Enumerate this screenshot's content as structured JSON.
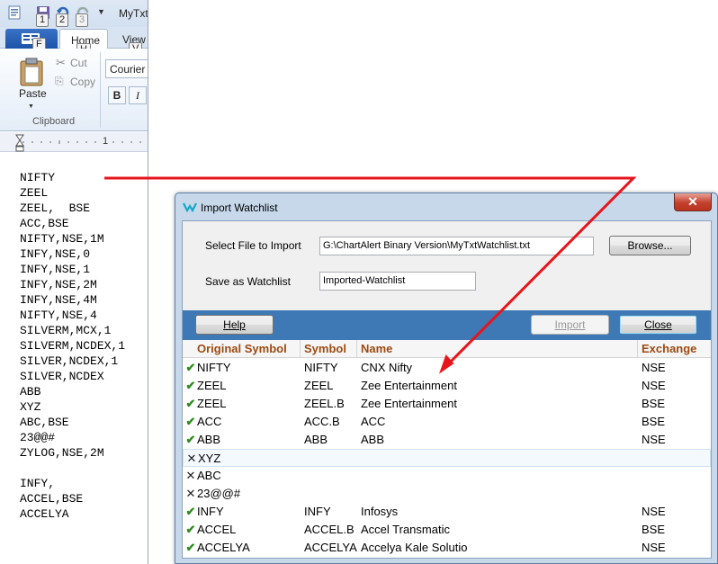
{
  "editor": {
    "quick_access": {
      "keytips": [
        "1",
        "2",
        "3"
      ],
      "title_truncated": "MyTxt"
    },
    "app_button_keytip": "F",
    "tabs": [
      {
        "label": "Home",
        "keytip": "H"
      },
      {
        "label": "View",
        "keytip": "V"
      }
    ],
    "clipboard": {
      "paste": "Paste",
      "cut": "Cut",
      "copy": "Copy",
      "group": "Clipboard"
    },
    "font": {
      "name": "Courier",
      "bold": "B",
      "italic": "I"
    },
    "ruler_mark": "1",
    "lines": [
      "NIFTY",
      "ZEEL",
      "ZEEL,  BSE",
      "ACC,BSE",
      "NIFTY,NSE,1M",
      "INFY,NSE,0",
      "INFY,NSE,1",
      "INFY,NSE,2M",
      "INFY,NSE,4M",
      "NIFTY,NSE,4",
      "SILVERM,MCX,1",
      "SILVERM,NCDEX,1",
      "SILVER,NCDEX,1",
      "SILVER,NCDEX",
      "ABB",
      "XYZ",
      "ABC,BSE",
      "23@@#",
      "ZYLOG,NSE,2M",
      "",
      "INFY,",
      "ACCEL,BSE",
      "ACCELYA"
    ]
  },
  "dialog": {
    "title": "Import Watchlist",
    "close_glyph": "✕",
    "select_file_label": "Select File to Import",
    "file_path": "G:\\ChartAlert Binary Version\\MyTxtWatchlist.txt",
    "browse_label": "Browse...",
    "save_as_label": "Save as Watchlist",
    "watchlist_name": "Imported-Watchlist",
    "help_label": "Help",
    "import_label": "Import",
    "close_label": "Close",
    "columns": [
      "Original Symbol",
      "Symbol",
      "Name",
      "Exchange"
    ],
    "rows": [
      {
        "status": "ok",
        "original": "NIFTY",
        "symbol": "NIFTY",
        "name": "CNX Nifty",
        "exchange": "NSE"
      },
      {
        "status": "ok",
        "original": "ZEEL",
        "symbol": "ZEEL",
        "name": "Zee Entertainment",
        "exchange": "NSE"
      },
      {
        "status": "ok",
        "original": "ZEEL",
        "symbol": "ZEEL.B",
        "name": "Zee Entertainment",
        "exchange": "BSE"
      },
      {
        "status": "ok",
        "original": "ACC",
        "symbol": "ACC.B",
        "name": "ACC",
        "exchange": "BSE"
      },
      {
        "status": "ok",
        "original": "ABB",
        "symbol": "ABB",
        "name": "ABB",
        "exchange": "NSE"
      },
      {
        "status": "bad",
        "original": "XYZ",
        "symbol": "",
        "name": "",
        "exchange": ""
      },
      {
        "status": "bad",
        "original": "ABC",
        "symbol": "",
        "name": "",
        "exchange": ""
      },
      {
        "status": "bad",
        "original": "23@@#",
        "symbol": "",
        "name": "",
        "exchange": ""
      },
      {
        "status": "ok",
        "original": "INFY",
        "symbol": "INFY",
        "name": "Infosys",
        "exchange": "NSE"
      },
      {
        "status": "ok",
        "original": "ACCEL",
        "symbol": "ACCEL.B",
        "name": "Accel Transmatic",
        "exchange": "BSE"
      },
      {
        "status": "ok",
        "original": "ACCELYA",
        "symbol": "ACCELYA",
        "name": "Accelya Kale Solutio",
        "exchange": "NSE"
      }
    ],
    "selected_row": 5
  },
  "colors": {
    "accent_bar": "#3f79b5",
    "header_text": "#9c4a12",
    "ok_mark": "#2e8b1e",
    "annotation_arrow": "#e8141b"
  }
}
